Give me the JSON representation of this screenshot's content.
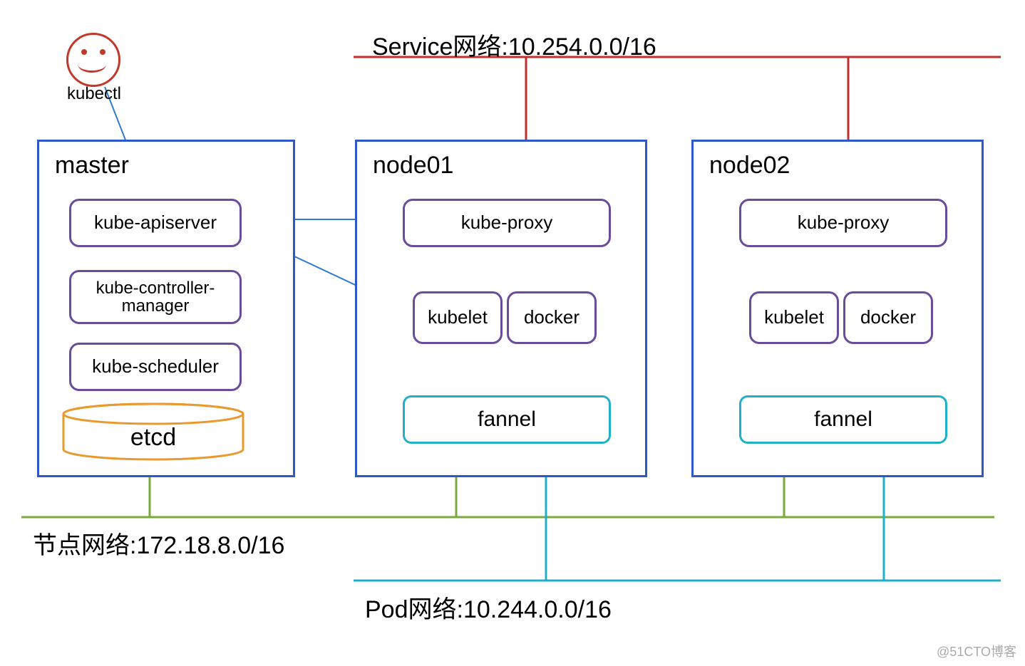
{
  "kubectl_label": "kubectl",
  "service_network_label": "Service网络:10.254.0.0/16",
  "node_network_label": "节点网络:172.18.8.0/16",
  "pod_network_label": "Pod网络:10.244.0.0/16",
  "master": {
    "title": "master",
    "apiserver": "kube-apiserver",
    "controller": "kube-controller-manager",
    "scheduler": "kube-scheduler",
    "etcd": "etcd"
  },
  "node01": {
    "title": "node01",
    "proxy": "kube-proxy",
    "kubelet": "kubelet",
    "docker": "docker",
    "flannel": "fannel"
  },
  "node02": {
    "title": "node02",
    "proxy": "kube-proxy",
    "kubelet": "kubelet",
    "docker": "docker",
    "flannel": "fannel"
  },
  "watermark": "@51CTO博客",
  "colors": {
    "blue": "#2e58c9",
    "purple": "#6a4c9c",
    "teal": "#21b0c9",
    "orange": "#e89a2e",
    "red_line": "#c02f2d",
    "green_line": "#7aa93c",
    "arrow_blue": "#2f7bd0"
  }
}
